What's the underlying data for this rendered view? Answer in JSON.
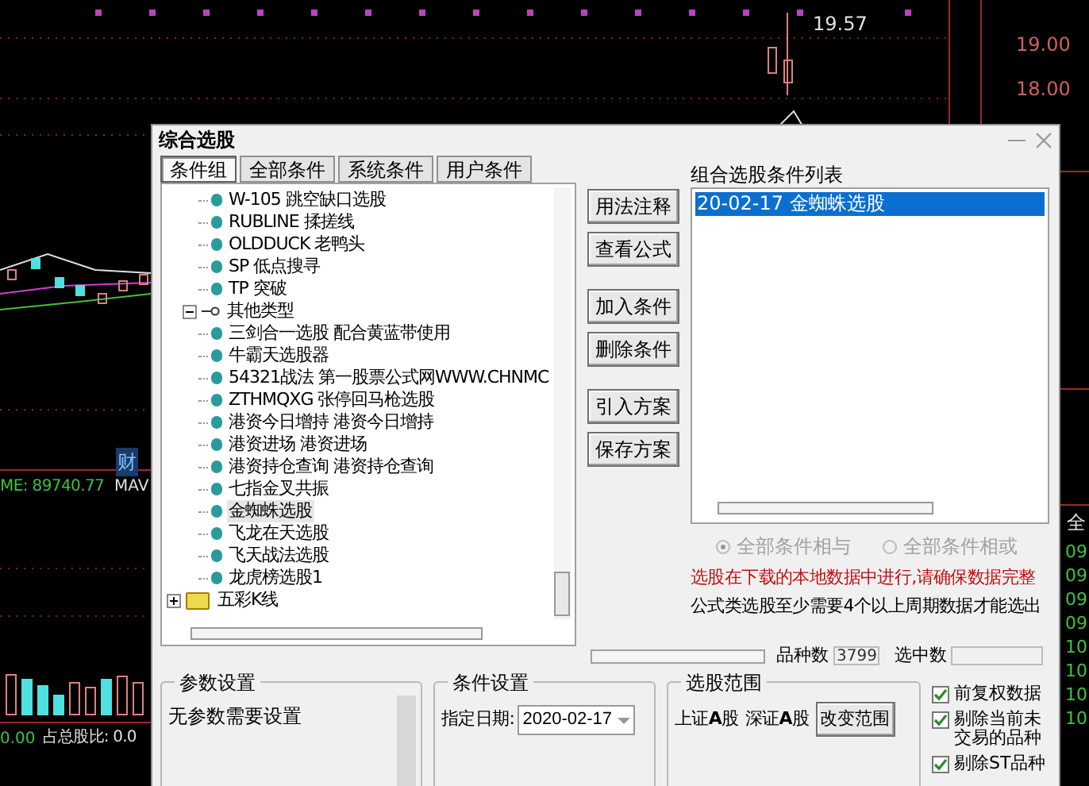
{
  "chart": {
    "price_labels": [
      {
        "text": "19.57",
        "kind": "peak"
      },
      {
        "text": "19.00",
        "kind": "axis"
      },
      {
        "text": "18.00",
        "kind": "axis"
      }
    ],
    "badge": "财",
    "volume_label": "ME: 89740.77",
    "volume_ma_label": "MAV",
    "bottom_labels": [
      "0.00",
      "占总股比: 0.0"
    ],
    "side_header": "全",
    "side_times": [
      "09",
      "09",
      "09",
      "09",
      "10",
      "10",
      "10",
      "10"
    ]
  },
  "dialog": {
    "title": "综合选股",
    "tabs": [
      {
        "label": "条件组",
        "selected": true
      },
      {
        "label": "全部条件",
        "selected": false
      },
      {
        "label": "系统条件",
        "selected": false
      },
      {
        "label": "用户条件",
        "selected": false
      }
    ],
    "tree": {
      "items": [
        {
          "children": [
            {
              "children": [
                {
                  "label": "W-105 跳空缺口选股",
                  "kind": "formula",
                  "selected": false
                },
                {
                  "label": "RUBLINE 揉搓线",
                  "kind": "formula",
                  "selected": false
                },
                {
                  "label": "OLDDUCK 老鸭头",
                  "kind": "formula",
                  "selected": false
                },
                {
                  "label": "SP 低点搜寻",
                  "kind": "formula",
                  "selected": false
                },
                {
                  "label": "TP 突破",
                  "kind": "formula",
                  "selected": false
                }
              ]
            },
            {
              "label": "其他类型",
              "kind": "group",
              "expanded": true,
              "children": [
                {
                  "label": "三剑合一选股 配合黄蓝带使用",
                  "kind": "formula",
                  "selected": false
                },
                {
                  "label": "牛霸天选股器",
                  "kind": "formula",
                  "selected": false
                },
                {
                  "label": "54321战法 第一股票公式网WWW.CHNMC",
                  "kind": "formula",
                  "selected": false
                },
                {
                  "label": "ZTHMQXG 张停回马枪选股",
                  "kind": "formula",
                  "selected": false
                },
                {
                  "label": "港资今日增持 港资今日增持",
                  "kind": "formula",
                  "selected": false
                },
                {
                  "label": "港资进场 港资进场",
                  "kind": "formula",
                  "selected": false
                },
                {
                  "label": "港资持仓查询 港资持仓查询",
                  "kind": "formula",
                  "selected": false
                },
                {
                  "label": "七指金叉共振",
                  "kind": "formula",
                  "selected": false
                },
                {
                  "label": "金蜘蛛选股",
                  "kind": "formula",
                  "selected": true
                },
                {
                  "label": "飞龙在天选股",
                  "kind": "formula",
                  "selected": false
                },
                {
                  "label": "飞天战法选股",
                  "kind": "formula",
                  "selected": false
                },
                {
                  "label": "龙虎榜选股1",
                  "kind": "formula",
                  "selected": false
                }
              ]
            }
          ]
        },
        {
          "label": "五彩K线",
          "kind": "folder",
          "expanded": false
        }
      ]
    },
    "buttons": [
      {
        "label": "用法注释",
        "kind": "top"
      },
      {
        "label": "查看公式",
        "kind": "top"
      },
      {
        "label": "加入条件",
        "kind": "mid"
      },
      {
        "label": "删除条件",
        "kind": "mid"
      },
      {
        "label": "引入方案",
        "kind": "low"
      },
      {
        "label": "保存方案",
        "kind": "low"
      }
    ],
    "condition_list": {
      "title": "组合选股条件列表",
      "items": [
        {
          "label": "20-02-17 金蜘蛛选股",
          "selected": true
        }
      ]
    },
    "logic": [
      {
        "label": "全部条件相与",
        "selected": true,
        "disabled": true
      },
      {
        "label": "全部条件相或",
        "selected": false,
        "disabled": true
      }
    ],
    "notes": [
      {
        "text": "选股在下载的本地数据中进行,请确保数据完整",
        "kind": "warning"
      },
      {
        "text": "公式类选股至少需要4个以上周期数据才能选出",
        "kind": "info"
      }
    ],
    "counts": {
      "total_label": "品种数",
      "total_value": "3799",
      "selected_label": "选中数"
    },
    "params": {
      "title": "参数设置",
      "text": "无参数需要设置"
    },
    "condition_settings": {
      "title": "条件设置",
      "date_label": "指定日期:",
      "date_value": "2020-02-17"
    },
    "scope": {
      "title": "选股范围",
      "markets": [
        "上证**A**股",
        "深证**A**股"
      ],
      "button": "改变范围"
    },
    "options": [
      {
        "label": "前复权数据",
        "checked": true
      },
      {
        "label": "剔除当前未交易的品种",
        "checked": true
      },
      {
        "label": "剔除ST品种",
        "checked": true
      }
    ]
  }
}
